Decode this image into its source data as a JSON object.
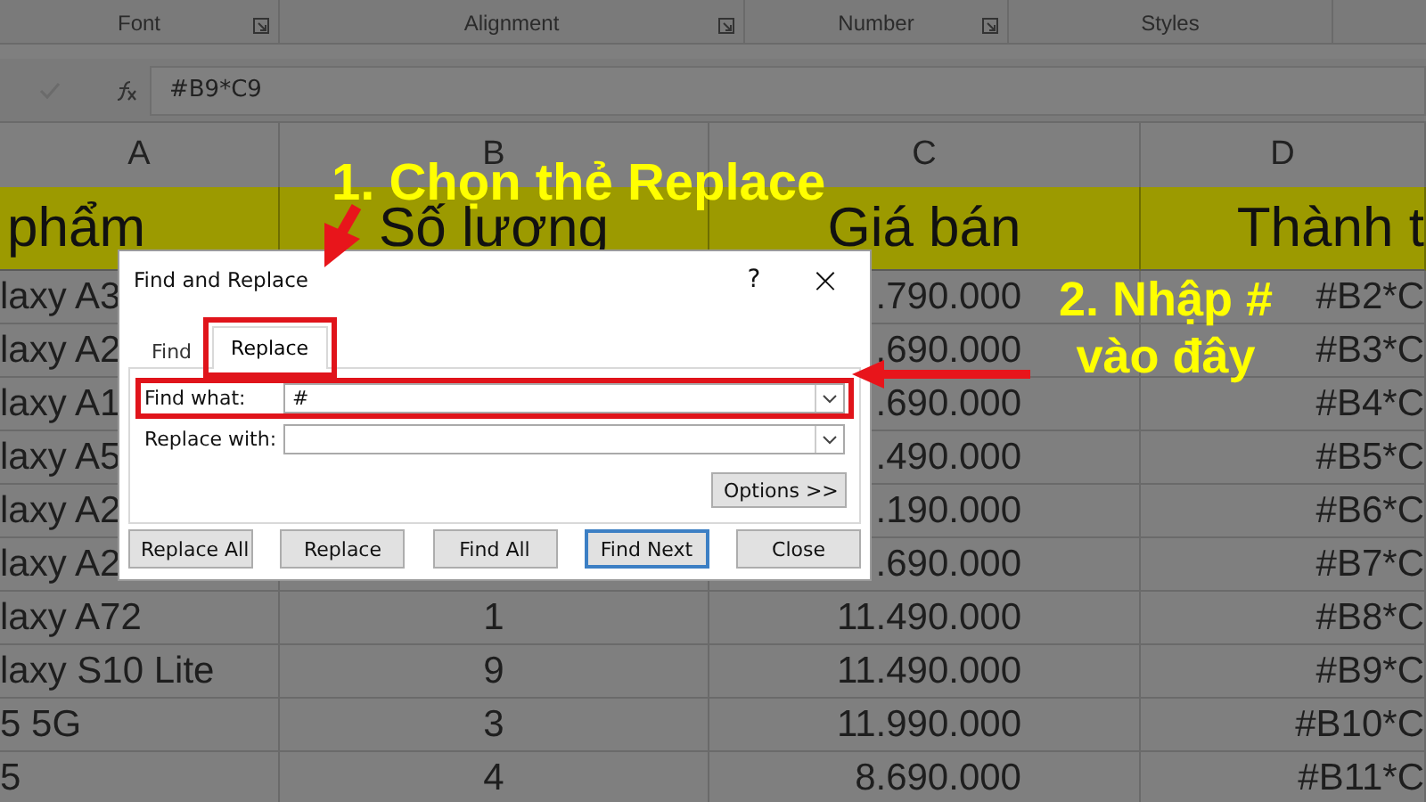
{
  "ribbon": {
    "groups": [
      {
        "label": "Font",
        "launcher": true
      },
      {
        "label": "Alignment",
        "launcher": true
      },
      {
        "label": "Number",
        "launcher": true
      },
      {
        "label": "Styles",
        "launcher": false
      }
    ]
  },
  "formula_bar": {
    "value": "#B9*C9"
  },
  "sheet": {
    "columns": [
      "A",
      "B",
      "C",
      "D"
    ],
    "header": [
      "phẩm",
      "Số lượng",
      "Giá bán",
      "Thành t"
    ],
    "rows": [
      {
        "cells": [
          "laxy A3",
          "",
          ".790.000",
          "#B2*C"
        ]
      },
      {
        "cells": [
          "laxy A2",
          "",
          ".690.000",
          "#B3*C"
        ]
      },
      {
        "cells": [
          "laxy A1",
          "",
          ".690.000",
          "#B4*C"
        ]
      },
      {
        "cells": [
          "laxy A5",
          "",
          ".490.000",
          "#B5*C"
        ]
      },
      {
        "cells": [
          "laxy A2",
          "",
          ".190.000",
          "#B6*C"
        ]
      },
      {
        "cells": [
          "laxy A2",
          "",
          ".690.000",
          "#B7*C"
        ]
      },
      {
        "cells": [
          "laxy A72",
          "1",
          "11.490.000",
          "#B8*C"
        ]
      },
      {
        "cells": [
          "laxy S10 Lite",
          "9",
          "11.490.000",
          "#B9*C"
        ]
      },
      {
        "cells": [
          "5 5G",
          "3",
          "11.990.000",
          "#B10*C"
        ]
      },
      {
        "cells": [
          "5",
          "4",
          "8.690.000",
          "#B11*C"
        ]
      }
    ]
  },
  "dialog": {
    "title": "Find and Replace",
    "help": "?",
    "close": "×",
    "tabs": [
      {
        "label": "Find",
        "selected": false,
        "highlighted": false
      },
      {
        "label": "Replace",
        "selected": true,
        "highlighted": true
      }
    ],
    "fields": [
      {
        "label": "Find what:",
        "value": "#",
        "highlighted": true
      },
      {
        "label": "Replace with:",
        "highlighted": false
      }
    ],
    "options_button": "Options >>",
    "buttons": [
      {
        "label": "Replace All",
        "default": false
      },
      {
        "label": "Replace",
        "default": false
      },
      {
        "label": "Find All",
        "default": false
      },
      {
        "label": "Find Next",
        "default": true
      },
      {
        "label": "Close",
        "default": false
      }
    ]
  },
  "callouts": [
    {
      "text": "1. Chọn thẻ Replace"
    },
    {
      "text": "2. Nhập # vào đây"
    }
  ]
}
